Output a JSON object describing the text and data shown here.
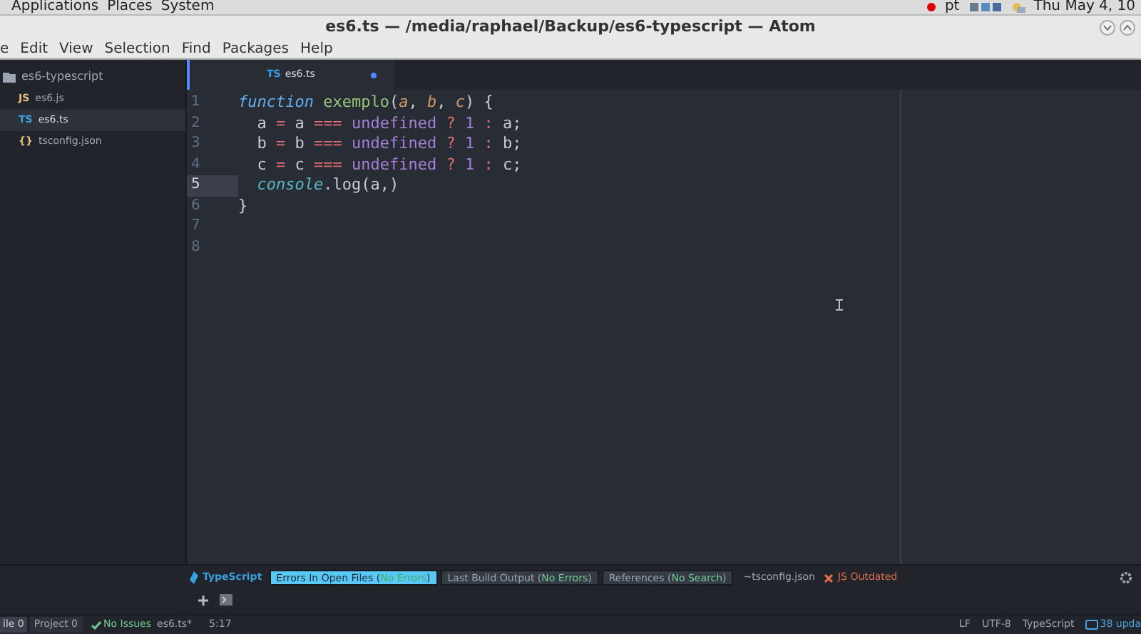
{
  "top_panel": {
    "menus": [
      "Applications",
      "Places",
      "System"
    ],
    "keyboard": "pt",
    "clock": "Thu May  4, 10"
  },
  "window": {
    "title": "es6.ts — /media/raphael/Backup/es6-typescript — Atom"
  },
  "menu_bar": [
    "e",
    "Edit",
    "View",
    "Selection",
    "Find",
    "Packages",
    "Help"
  ],
  "tree": {
    "root": "es6-typescript",
    "children": [
      {
        "name": "es6.js",
        "kind": "js",
        "icon": "JS",
        "selected": false
      },
      {
        "name": "es6.ts",
        "kind": "ts",
        "icon": "TS",
        "selected": true
      },
      {
        "name": "tsconfig.json",
        "kind": "json",
        "icon": "{}",
        "selected": false
      }
    ]
  },
  "tabs": [
    {
      "icon": "TS",
      "label": "es6.ts",
      "modified": true,
      "selected": true
    }
  ],
  "editor": {
    "lines": [
      {
        "number": "1",
        "current": false,
        "tokens": [
          {
            "kind": "keyword",
            "text": "function "
          },
          {
            "kind": "function",
            "text": "exemplo"
          },
          {
            "kind": "plain",
            "text": "("
          },
          {
            "kind": "param",
            "text": "a"
          },
          {
            "kind": "plain",
            "text": ", "
          },
          {
            "kind": "param",
            "text": "b"
          },
          {
            "kind": "plain",
            "text": ", "
          },
          {
            "kind": "param",
            "text": "c"
          },
          {
            "kind": "plain",
            "text": ") {"
          }
        ]
      },
      {
        "number": "2",
        "current": false,
        "tokens": [
          {
            "kind": "plain",
            "text": "  a "
          },
          {
            "kind": "operator",
            "text": "= "
          },
          {
            "kind": "plain",
            "text": "a "
          },
          {
            "kind": "operator",
            "text": "=== "
          },
          {
            "kind": "constant",
            "text": "undefined "
          },
          {
            "kind": "operator",
            "text": "? "
          },
          {
            "kind": "constant",
            "text": "1 "
          },
          {
            "kind": "operator",
            "text": ": "
          },
          {
            "kind": "plain",
            "text": "a;"
          }
        ]
      },
      {
        "number": "3",
        "current": false,
        "tokens": [
          {
            "kind": "plain",
            "text": "  b "
          },
          {
            "kind": "operator",
            "text": "= "
          },
          {
            "kind": "plain",
            "text": "b "
          },
          {
            "kind": "operator",
            "text": "=== "
          },
          {
            "kind": "constant",
            "text": "undefined "
          },
          {
            "kind": "operator",
            "text": "? "
          },
          {
            "kind": "constant",
            "text": "1 "
          },
          {
            "kind": "operator",
            "text": ": "
          },
          {
            "kind": "plain",
            "text": "b;"
          }
        ]
      },
      {
        "number": "4",
        "current": false,
        "tokens": [
          {
            "kind": "plain",
            "text": "  c "
          },
          {
            "kind": "operator",
            "text": "= "
          },
          {
            "kind": "plain",
            "text": "c "
          },
          {
            "kind": "operator",
            "text": "=== "
          },
          {
            "kind": "constant",
            "text": "undefined "
          },
          {
            "kind": "operator",
            "text": "? "
          },
          {
            "kind": "constant",
            "text": "1 "
          },
          {
            "kind": "operator",
            "text": ": "
          },
          {
            "kind": "plain",
            "text": "c;"
          }
        ]
      },
      {
        "number": "5",
        "current": true,
        "tokens": [
          {
            "kind": "builtin",
            "text": "  console"
          },
          {
            "kind": "plain",
            "text": ".log(a,)"
          }
        ]
      },
      {
        "number": "6",
        "current": false,
        "tokens": [
          {
            "kind": "plain",
            "text": "}"
          }
        ]
      },
      {
        "number": "7",
        "current": false
      },
      {
        "number": "8",
        "current": false
      }
    ]
  },
  "ts_panel": {
    "brand": "TypeScript",
    "tabs": [
      {
        "prefix": "Errors In Open Files (",
        "status": "No Errors",
        "suffix": ")",
        "selected": true
      },
      {
        "prefix": "Last Build Output (",
        "status": "No Errors",
        "suffix": ")",
        "selected": false
      },
      {
        "prefix": "References (",
        "status": "No Search",
        "suffix": ")",
        "selected": false
      }
    ],
    "config": "~tsconfig.json",
    "js_status": "JS Outdated"
  },
  "status_bar": {
    "file": "ile 0",
    "project": "Project 0",
    "issues": "No Issues",
    "filename": "es6.ts*",
    "position": "5:17",
    "line_ending": "LF",
    "encoding": "UTF-8",
    "grammar": "TypeScript",
    "updates": "38 upda"
  }
}
